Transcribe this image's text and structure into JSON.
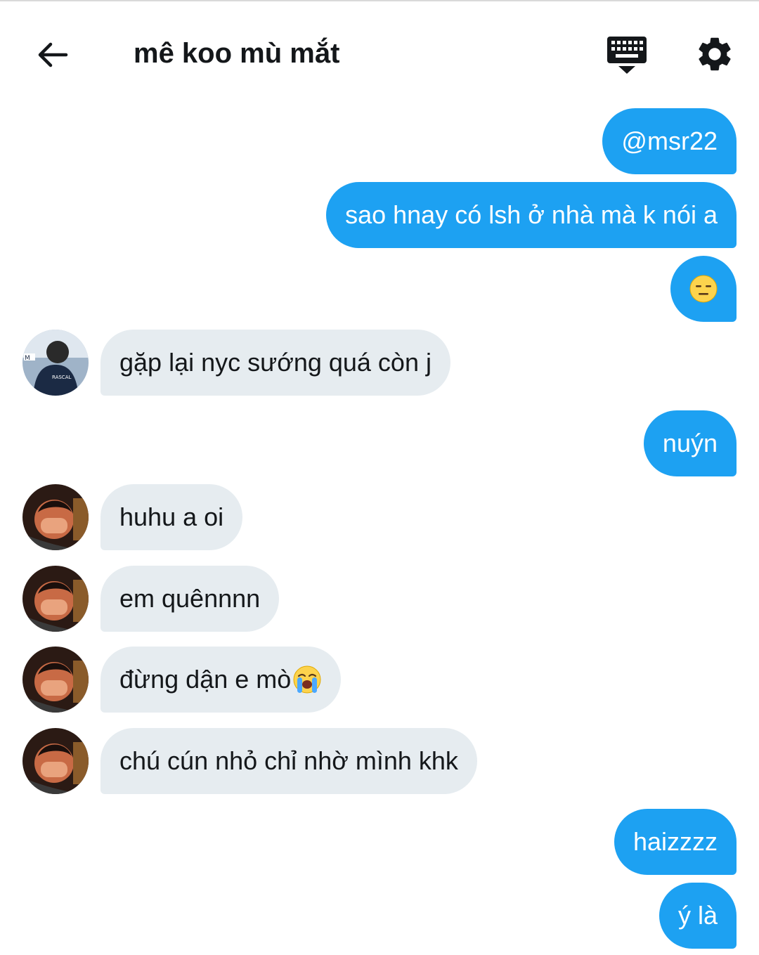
{
  "header": {
    "title": "mê koo mù mắt",
    "back_icon": "arrow-left-icon",
    "keyboard_icon": "keyboard-icon",
    "settings_icon": "gear-icon"
  },
  "colors": {
    "outgoing_bubble": "#1da1f2",
    "incoming_bubble": "#e6ecf0",
    "text_dark": "#14171a"
  },
  "messages": [
    {
      "direction": "out",
      "text": "@msr22"
    },
    {
      "direction": "out",
      "text": "sao hnay có lsh ở nhà mà k nói a"
    },
    {
      "direction": "out",
      "text": "",
      "emoji": "expressionless-face-emoji"
    },
    {
      "direction": "in",
      "text": "gặp lại nyc sướng quá còn j"
    },
    {
      "direction": "out",
      "text": "nuýn"
    },
    {
      "direction": "in",
      "text": "huhu a oi"
    },
    {
      "direction": "in",
      "text": "em quênnnn"
    },
    {
      "direction": "in",
      "text": "đừng dận e mò",
      "emoji": "loudly-crying-face-emoji"
    },
    {
      "direction": "in",
      "text": "chú cún nhỏ chỉ nhờ mình khk"
    },
    {
      "direction": "out",
      "text": "haizzzz"
    },
    {
      "direction": "out",
      "text": "ý là"
    }
  ]
}
